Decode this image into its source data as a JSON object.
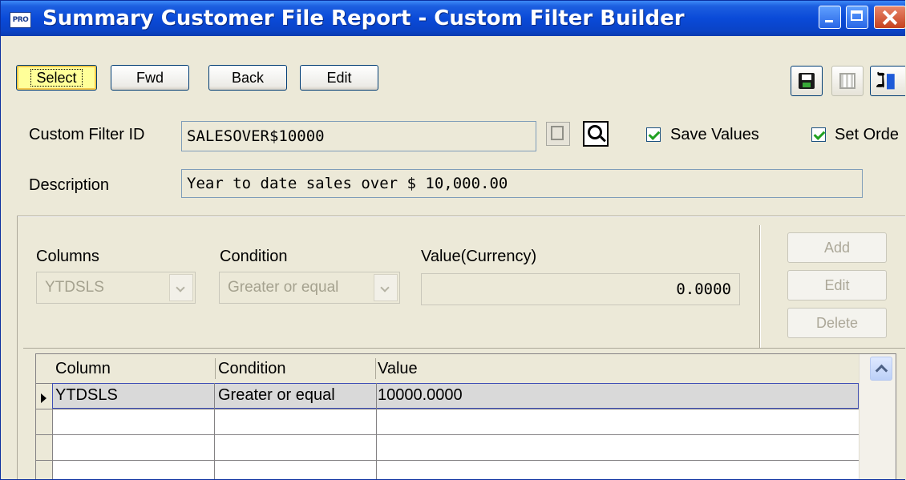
{
  "window": {
    "title": "Summary Customer File Report - Custom Filter Builder",
    "app_icon_text": "PRO"
  },
  "toolbar": {
    "select_label": "Select",
    "fwd_label": "Fwd",
    "back_label": "Back",
    "edit_label": "Edit"
  },
  "header": {
    "filter_id_label": "Custom Filter ID",
    "filter_id_value": "SALESOVER$10000",
    "description_label": "Description",
    "description_value": "Year to date sales over $ 10,000.00",
    "save_values_label": "Save Values",
    "save_values_checked": true,
    "set_order_label": "Set Orde",
    "set_order_checked": true
  },
  "filter_editor": {
    "columns_label": "Columns",
    "columns_value": "YTDSLS",
    "condition_label": "Condition",
    "condition_value": "Greater or equal",
    "value_label": "Value(Currency)",
    "value_value": "0.0000",
    "add_label": "Add",
    "edit_label": "Edit",
    "delete_label": "Delete"
  },
  "grid": {
    "headers": [
      "Column",
      "Condition",
      "Value"
    ],
    "rows": [
      [
        "YTDSLS",
        "Greater or equal",
        "10000.0000"
      ]
    ]
  }
}
